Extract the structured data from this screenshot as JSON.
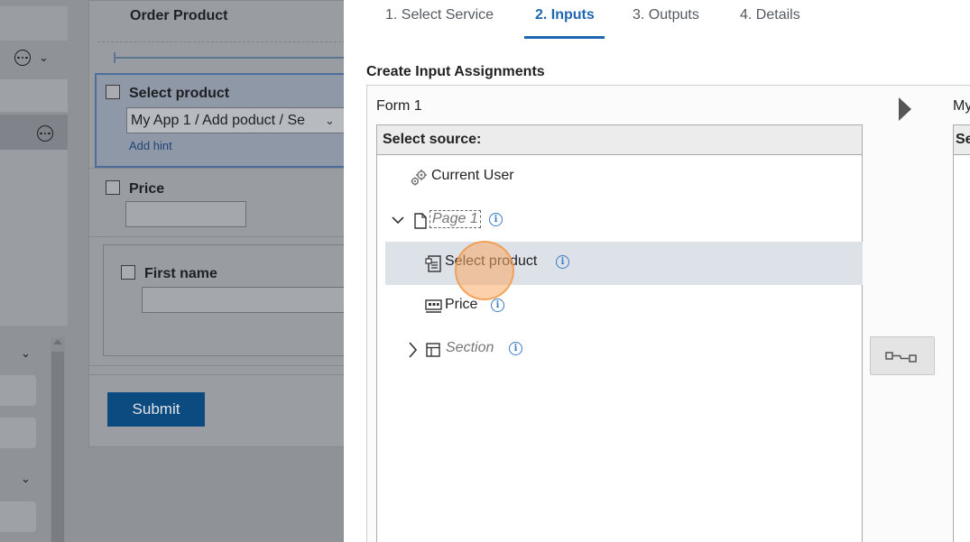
{
  "background_app": {
    "page_title": "Order Product",
    "select_product_label": "Select product",
    "select_product_value": "My App 1 / Add poduct / Se",
    "add_hint": "Add hint",
    "price_label": "Price",
    "first_name_label": "First name",
    "submit_label": "Submit"
  },
  "dialog": {
    "tabs": [
      {
        "label": "1. Select Service"
      },
      {
        "label": "2. Inputs"
      },
      {
        "label": "3. Outputs"
      },
      {
        "label": "4. Details"
      }
    ],
    "active_tab": "2. Inputs",
    "section_title": "Create Input Assignments",
    "form_label": "Form 1",
    "target_label_partial": "My",
    "source_header": "Select source:",
    "target_header_partial": "Se",
    "tree": [
      {
        "label": "Current User",
        "icon": "gear-cluster-icon"
      },
      {
        "label": "Page 1",
        "icon": "page-icon",
        "expanded": true
      },
      {
        "label": "Select product",
        "icon": "dropdown-field-icon",
        "selected": true
      },
      {
        "label": "Price",
        "icon": "text-field-icon"
      },
      {
        "label": "Section",
        "icon": "section-icon",
        "expanded": false
      }
    ],
    "colors": {
      "accent": "#1f66b0",
      "selected_row": "#dde1e8",
      "info": "#3a7cc7"
    }
  }
}
